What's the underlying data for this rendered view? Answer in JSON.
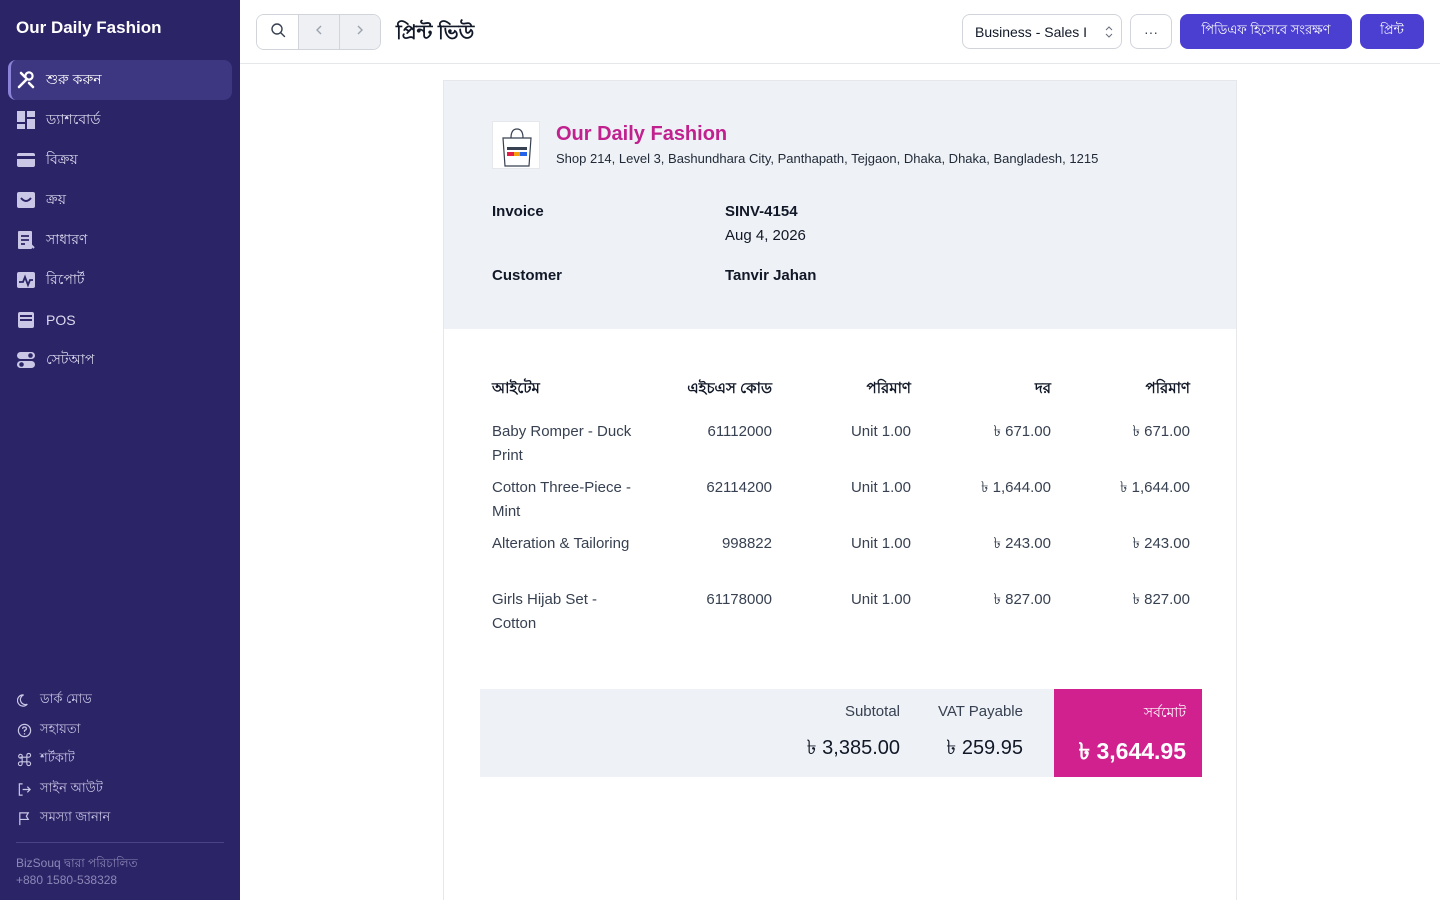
{
  "sidebar": {
    "brand": "Our Daily Fashion",
    "items": [
      {
        "label": "শুরু করুন",
        "icon": "tools-icon"
      },
      {
        "label": "ড্যাশবোর্ড",
        "icon": "dashboard-icon"
      },
      {
        "label": "বিক্রয়",
        "icon": "credit-card-icon"
      },
      {
        "label": "ক্রয়",
        "icon": "inbox-icon"
      },
      {
        "label": "সাধারণ",
        "icon": "ledger-icon"
      },
      {
        "label": "রিপোর্ট",
        "icon": "chart-icon"
      },
      {
        "label": "POS",
        "icon": "register-icon"
      },
      {
        "label": "সেটআপ",
        "icon": "toggle-icon"
      }
    ],
    "footer": [
      {
        "label": "ডার্ক মোড",
        "icon": "moon-icon"
      },
      {
        "label": "সহায়তা",
        "icon": "help-icon"
      },
      {
        "label": "শর্টকাট",
        "icon": "command-icon"
      },
      {
        "label": "সাইন আউট",
        "icon": "logout-icon"
      },
      {
        "label": "সমস্যা জানান",
        "icon": "flag-icon"
      }
    ],
    "powered_by": "BizSouq দ্বারা পরিচালিত",
    "phone": "+880 1580-538328"
  },
  "topbar": {
    "title": "প্রিন্ট ভিউ",
    "template_select": "Business - Sales I",
    "more_label": "···",
    "pdf_label": "পিডিএফ হিসেবে সংরক্ষণ",
    "print_label": "প্রিন্ট"
  },
  "invoice": {
    "company": "Our Daily Fashion",
    "address": "Shop 214, Level 3, Bashundhara City, Panthapath, Tejgaon, Dhaka, Dhaka, Bangladesh, 1215",
    "invoice_label": "Invoice",
    "invoice_no": "SINV-4154",
    "date": "Aug 4, 2026",
    "customer_label": "Customer",
    "customer": "Tanvir Jahan",
    "columns": [
      "আইটেম",
      "এইচএস কোড",
      "পরিমাণ",
      "দর",
      "পরিমাণ"
    ],
    "rows": [
      {
        "item": "Baby Romper - Duck Print",
        "hsn": "61112000",
        "qty": "Unit 1.00",
        "rate": "৳ 671.00",
        "amount": "৳ 671.00"
      },
      {
        "item": "Cotton Three-Piece - Mint",
        "hsn": "62114200",
        "qty": "Unit 1.00",
        "rate": "৳ 1,644.00",
        "amount": "৳ 1,644.00"
      },
      {
        "item": "Alteration & Tailoring",
        "hsn": "998822",
        "qty": "Unit 1.00",
        "rate": "৳ 243.00",
        "amount": "৳ 243.00"
      },
      {
        "item": "Girls Hijab Set - Cotton",
        "hsn": "61178000",
        "qty": "Unit 1.00",
        "rate": "৳ 827.00",
        "amount": "৳ 827.00"
      }
    ],
    "subtotal_label": "Subtotal",
    "subtotal": "৳ 3,385.00",
    "vat_label": "VAT Payable",
    "vat": "৳ 259.95",
    "grand_label": "সর্বমোট",
    "grand_total": "৳ 3,644.95"
  },
  "colors": {
    "sidebar_bg": "#2b2466",
    "primary": "#4b3fd1",
    "accent": "#d0218f"
  }
}
